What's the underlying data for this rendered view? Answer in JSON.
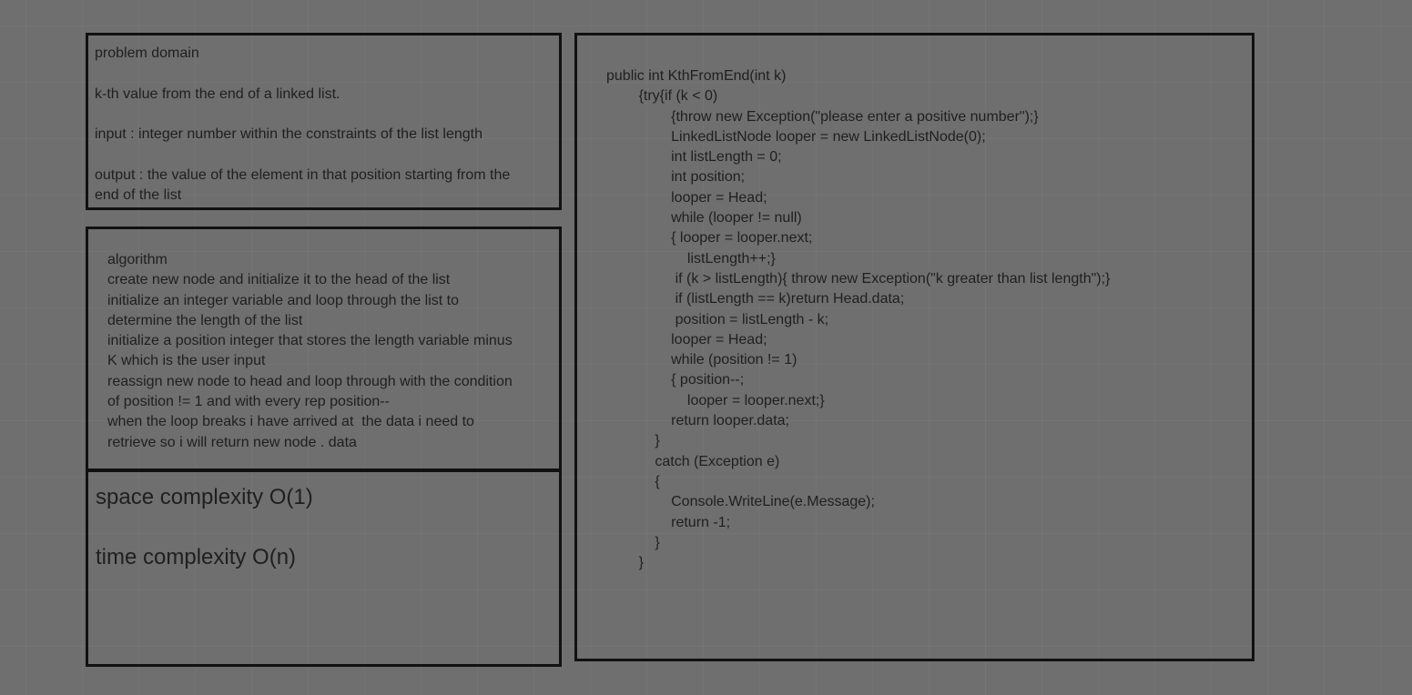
{
  "problem_domain": {
    "heading": "problem domain",
    "description": "k-th value from the end of a linked list.",
    "input": "input : integer number within the constraints of the list length",
    "output_line_1": "output : the value of the element in that position starting from the",
    "output_line_2": "end of the list"
  },
  "algorithm": {
    "lines": [
      "algorithm",
      "create new node and initialize it to the head of the list",
      "initialize an integer variable and loop through the list to",
      "determine the length of the list",
      "initialize a position integer that stores the length variable minus",
      "K which is the user input",
      "reassign new node to head and loop through with the condition",
      "of position != 1 and with every rep position--",
      "when the loop breaks i have arrived at  the data i need to",
      "retrieve so i will return new node . data"
    ]
  },
  "complexity": {
    "space": "space complexity O(1)",
    "time": "time complexity O(n)"
  },
  "code": {
    "lines": [
      "public int KthFromEnd(int k)",
      "        {try{if (k < 0)",
      "                {throw new Exception(\"please enter a positive number\");}",
      "                LinkedListNode looper = new LinkedListNode(0);",
      "                int listLength = 0;",
      "                int position;",
      "                looper = Head;",
      "                while (looper != null)",
      "                { looper = looper.next;",
      "                    listLength++;}",
      "                 if (k > listLength){ throw new Exception(\"k greater than list length\");}",
      "                 if (listLength == k)return Head.data;",
      "                 position = listLength - k;",
      "                looper = Head;",
      "                while (position != 1)",
      "                { position--;",
      "                    looper = looper.next;}",
      "                return looper.data;",
      "            }",
      "            catch (Exception e)",
      "            {",
      "                Console.WriteLine(e.Message);",
      "                return -1;",
      "            }",
      "        }"
    ]
  }
}
